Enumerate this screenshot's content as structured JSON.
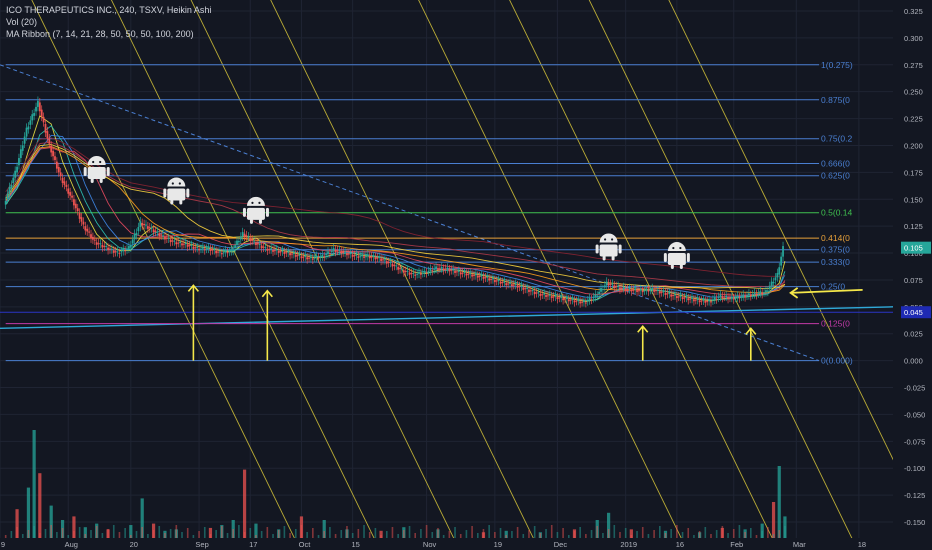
{
  "legend": {
    "title": "ICO THERAPEUTICS INC., 240, TSXV, Heikin Ashi",
    "volume": "Vol (20)",
    "ma_ribbon": "MA Ribbon (7, 14, 21, 28, 50, 50, 50, 100, 200)"
  },
  "colors": {
    "background": "#131722",
    "grid": "#1f2433",
    "up_candle": "#26a69a",
    "down_candle": "#ef5350",
    "fib_blue": "#4a7fd1",
    "fib_green": "#3fc04f",
    "fib_orange": "#e8a13a",
    "fib_magenta": "#c23aa7",
    "fib_navy": "#2b35c4",
    "trend_cyan": "#2fa9d8",
    "channel_yellow": "#d8c63a",
    "arrow_yellow": "#f5e84a",
    "price_badge": "#26a69a",
    "price_badge_navy": "#1e2ab3"
  },
  "chart_data": {
    "type": "candlestick",
    "price_axis": {
      "ticks": [
        "0.325",
        "0.300",
        "0.275",
        "0.250",
        "0.225",
        "0.200",
        "0.175",
        "0.150",
        "0.125",
        "0.100",
        "0.075",
        "0.050",
        "0.025",
        "0.000",
        "-0.025",
        "-0.050",
        "-0.075",
        "-0.100",
        "-0.125",
        "-0.150"
      ],
      "range": [
        -0.15,
        0.325
      ]
    },
    "time_axis": {
      "ticks": [
        "9",
        "Aug",
        "20",
        "Sep",
        "17",
        "Oct",
        "15",
        "Nov",
        "19",
        "Dec",
        "2019",
        "16",
        "Feb",
        "Mar",
        "18"
      ]
    },
    "last_price": "0.105",
    "secondary_price": "0.045",
    "fib_levels": [
      {
        "label": "1(0.275)",
        "value": 0.275,
        "color": "blue"
      },
      {
        "label": "0.875(0",
        "value": 0.2425,
        "color": "blue"
      },
      {
        "label": "0.75(0.2",
        "value": 0.2063,
        "color": "blue"
      },
      {
        "label": "0.666(0",
        "value": 0.1833,
        "color": "blue"
      },
      {
        "label": "0.625(0",
        "value": 0.1719,
        "color": "blue"
      },
      {
        "label": "0.5(0.14",
        "value": 0.1375,
        "color": "green"
      },
      {
        "label": "0.414(0",
        "value": 0.1139,
        "color": "orange"
      },
      {
        "label": "0.375(0",
        "value": 0.1031,
        "color": "blue"
      },
      {
        "label": "0.333(0",
        "value": 0.0916,
        "color": "blue"
      },
      {
        "label": "0.25(0",
        "value": 0.0688,
        "color": "blue"
      },
      {
        "label": "0.125(0",
        "value": 0.0344,
        "color": "magenta"
      },
      {
        "label": "0(0.000)",
        "value": 0.0,
        "color": "blue"
      }
    ],
    "price_series": [
      {
        "t": 0,
        "p": 0.145
      },
      {
        "t": 2,
        "p": 0.175
      },
      {
        "t": 4,
        "p": 0.215
      },
      {
        "t": 6,
        "p": 0.24
      },
      {
        "t": 8,
        "p": 0.2
      },
      {
        "t": 10,
        "p": 0.17
      },
      {
        "t": 12,
        "p": 0.15
      },
      {
        "t": 14,
        "p": 0.125
      },
      {
        "t": 16,
        "p": 0.11
      },
      {
        "t": 18,
        "p": 0.105
      },
      {
        "t": 20,
        "p": 0.1
      },
      {
        "t": 22,
        "p": 0.105
      },
      {
        "t": 24,
        "p": 0.128
      },
      {
        "t": 26,
        "p": 0.122
      },
      {
        "t": 28,
        "p": 0.115
      },
      {
        "t": 30,
        "p": 0.11
      },
      {
        "t": 32,
        "p": 0.108
      },
      {
        "t": 34,
        "p": 0.104
      },
      {
        "t": 36,
        "p": 0.104
      },
      {
        "t": 38,
        "p": 0.1
      },
      {
        "t": 40,
        "p": 0.102
      },
      {
        "t": 42,
        "p": 0.118
      },
      {
        "t": 44,
        "p": 0.11
      },
      {
        "t": 46,
        "p": 0.104
      },
      {
        "t": 48,
        "p": 0.102
      },
      {
        "t": 50,
        "p": 0.1
      },
      {
        "t": 52,
        "p": 0.097
      },
      {
        "t": 54,
        "p": 0.095
      },
      {
        "t": 56,
        "p": 0.097
      },
      {
        "t": 58,
        "p": 0.103
      },
      {
        "t": 60,
        "p": 0.1
      },
      {
        "t": 62,
        "p": 0.097
      },
      {
        "t": 64,
        "p": 0.097
      },
      {
        "t": 66,
        "p": 0.095
      },
      {
        "t": 68,
        "p": 0.09
      },
      {
        "t": 70,
        "p": 0.084
      },
      {
        "t": 72,
        "p": 0.08
      },
      {
        "t": 74,
        "p": 0.082
      },
      {
        "t": 76,
        "p": 0.086
      },
      {
        "t": 78,
        "p": 0.085
      },
      {
        "t": 80,
        "p": 0.082
      },
      {
        "t": 82,
        "p": 0.08
      },
      {
        "t": 84,
        "p": 0.078
      },
      {
        "t": 86,
        "p": 0.075
      },
      {
        "t": 88,
        "p": 0.072
      },
      {
        "t": 90,
        "p": 0.07
      },
      {
        "t": 92,
        "p": 0.066
      },
      {
        "t": 94,
        "p": 0.062
      },
      {
        "t": 96,
        "p": 0.06
      },
      {
        "t": 98,
        "p": 0.058
      },
      {
        "t": 100,
        "p": 0.056
      },
      {
        "t": 102,
        "p": 0.054
      },
      {
        "t": 104,
        "p": 0.06
      },
      {
        "t": 106,
        "p": 0.072
      },
      {
        "t": 108,
        "p": 0.068
      },
      {
        "t": 110,
        "p": 0.066
      },
      {
        "t": 112,
        "p": 0.065
      },
      {
        "t": 114,
        "p": 0.066
      },
      {
        "t": 116,
        "p": 0.063
      },
      {
        "t": 118,
        "p": 0.06
      },
      {
        "t": 120,
        "p": 0.058
      },
      {
        "t": 122,
        "p": 0.056
      },
      {
        "t": 124,
        "p": 0.055
      },
      {
        "t": 126,
        "p": 0.06
      },
      {
        "t": 128,
        "p": 0.058
      },
      {
        "t": 130,
        "p": 0.06
      },
      {
        "t": 132,
        "p": 0.062
      },
      {
        "t": 134,
        "p": 0.064
      },
      {
        "t": 136,
        "p": 0.08
      },
      {
        "t": 137,
        "p": 0.105
      }
    ],
    "volume_series": [
      {
        "t": 2,
        "v": 40
      },
      {
        "t": 4,
        "v": 70
      },
      {
        "t": 5,
        "v": 150
      },
      {
        "t": 6,
        "v": 90
      },
      {
        "t": 8,
        "v": 45
      },
      {
        "t": 10,
        "v": 25
      },
      {
        "t": 12,
        "v": 30
      },
      {
        "t": 14,
        "v": 15
      },
      {
        "t": 16,
        "v": 20
      },
      {
        "t": 18,
        "v": 12
      },
      {
        "t": 22,
        "v": 18
      },
      {
        "t": 24,
        "v": 55
      },
      {
        "t": 26,
        "v": 20
      },
      {
        "t": 28,
        "v": 10
      },
      {
        "t": 30,
        "v": 12
      },
      {
        "t": 36,
        "v": 14
      },
      {
        "t": 38,
        "v": 18
      },
      {
        "t": 40,
        "v": 25
      },
      {
        "t": 42,
        "v": 95
      },
      {
        "t": 44,
        "v": 20
      },
      {
        "t": 48,
        "v": 12
      },
      {
        "t": 52,
        "v": 30
      },
      {
        "t": 56,
        "v": 25
      },
      {
        "t": 60,
        "v": 12
      },
      {
        "t": 66,
        "v": 10
      },
      {
        "t": 70,
        "v": 15
      },
      {
        "t": 76,
        "v": 12
      },
      {
        "t": 84,
        "v": 8
      },
      {
        "t": 88,
        "v": 10
      },
      {
        "t": 94,
        "v": 8
      },
      {
        "t": 100,
        "v": 12
      },
      {
        "t": 104,
        "v": 25
      },
      {
        "t": 106,
        "v": 35
      },
      {
        "t": 110,
        "v": 12
      },
      {
        "t": 116,
        "v": 10
      },
      {
        "t": 122,
        "v": 8
      },
      {
        "t": 126,
        "v": 14
      },
      {
        "t": 130,
        "v": 12
      },
      {
        "t": 133,
        "v": 20
      },
      {
        "t": 135,
        "v": 50
      },
      {
        "t": 136,
        "v": 100
      },
      {
        "t": 137,
        "v": 30
      }
    ]
  },
  "annotations": {
    "robot_markers": [
      {
        "t": 16,
        "p": 0.18
      },
      {
        "t": 30,
        "p": 0.16
      },
      {
        "t": 44,
        "p": 0.142
      },
      {
        "t": 106,
        "p": 0.108
      },
      {
        "t": 118,
        "p": 0.1
      }
    ],
    "up_arrows": [
      {
        "t": 33,
        "from": 0.0,
        "to": 0.07
      },
      {
        "t": 46,
        "from": 0.0,
        "to": 0.065
      },
      {
        "t": 112,
        "from": 0.0,
        "to": 0.032
      },
      {
        "t": 131,
        "from": 0.0,
        "to": 0.03
      }
    ],
    "left_arrow": {
      "t": 138,
      "p": 0.063
    }
  }
}
